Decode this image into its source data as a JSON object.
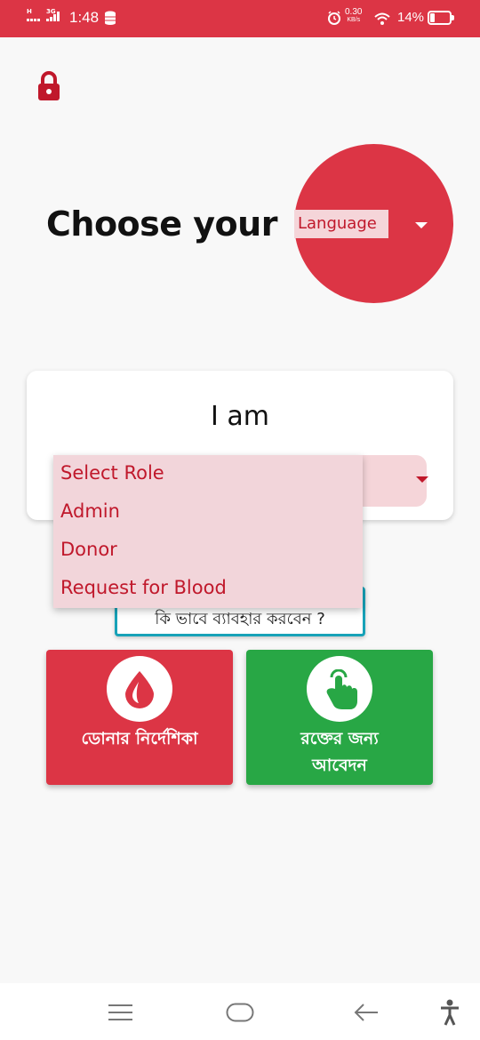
{
  "status_bar": {
    "network_tags": [
      "H",
      "3G"
    ],
    "time": "1:48",
    "net_speed_value": "0.30",
    "net_speed_unit": "KB/s",
    "battery_percent": "14%"
  },
  "colors": {
    "primary": "#dc3545",
    "success": "#28a745",
    "info": "#17a2b8",
    "select_bg": "#f5d5d9"
  },
  "language_section": {
    "title": "Choose your",
    "select_value": "Language"
  },
  "role_card": {
    "title": "I am",
    "options": [
      "Select Role",
      "Admin",
      "Donor",
      "Request for Blood"
    ]
  },
  "howto_button": {
    "label": "কি ভাবে ব্যাবহার করবেন ?"
  },
  "tiles": {
    "donor_guide": {
      "label": "ডোনার নির্দেশিকা",
      "icon": "blood-drop-icon"
    },
    "request_blood": {
      "label_line1": "রক্তের জন্য",
      "label_line2": "আবেদন",
      "icon": "tap-hand-icon"
    }
  },
  "nav_bar": {
    "icons": [
      "menu-icon",
      "home-icon",
      "back-icon",
      "accessibility-icon"
    ]
  }
}
